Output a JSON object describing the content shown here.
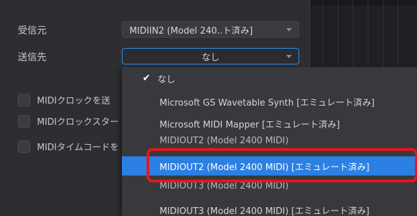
{
  "labels": {
    "receive_from": "受信元",
    "send_to": "送信先"
  },
  "source_combo": {
    "value": "MIDIIN2 (Model 240..ト済み]"
  },
  "dest_combo": {
    "value": "なし"
  },
  "checkboxes": [
    {
      "label": "MIDIクロックを送"
    },
    {
      "label": "MIDIクロックスター"
    },
    {
      "label": "MIDIタイムコードを"
    }
  ],
  "menu": {
    "items": [
      {
        "label": "なし",
        "checked": true
      },
      {
        "label": "Microsoft GS Wavetable Synth [エミュレート済み]"
      },
      {
        "label": "Microsoft MIDI Mapper [エミュレート済み]"
      },
      {
        "label": "MIDIOUT2 (Model 2400 MIDI)"
      },
      {
        "label": "MIDIOUT2 (Model 2400 MIDI) [エミュレート済み]",
        "selected": true
      },
      {
        "label": "MIDIOUT3 (Model 2400 MIDI)"
      },
      {
        "label": "MIDIOUT3 (Model 2400 MIDI) [エミュレート済み]"
      }
    ]
  },
  "colors": {
    "highlight": "#2c7fe3",
    "annotation_box": "#e4171c"
  }
}
